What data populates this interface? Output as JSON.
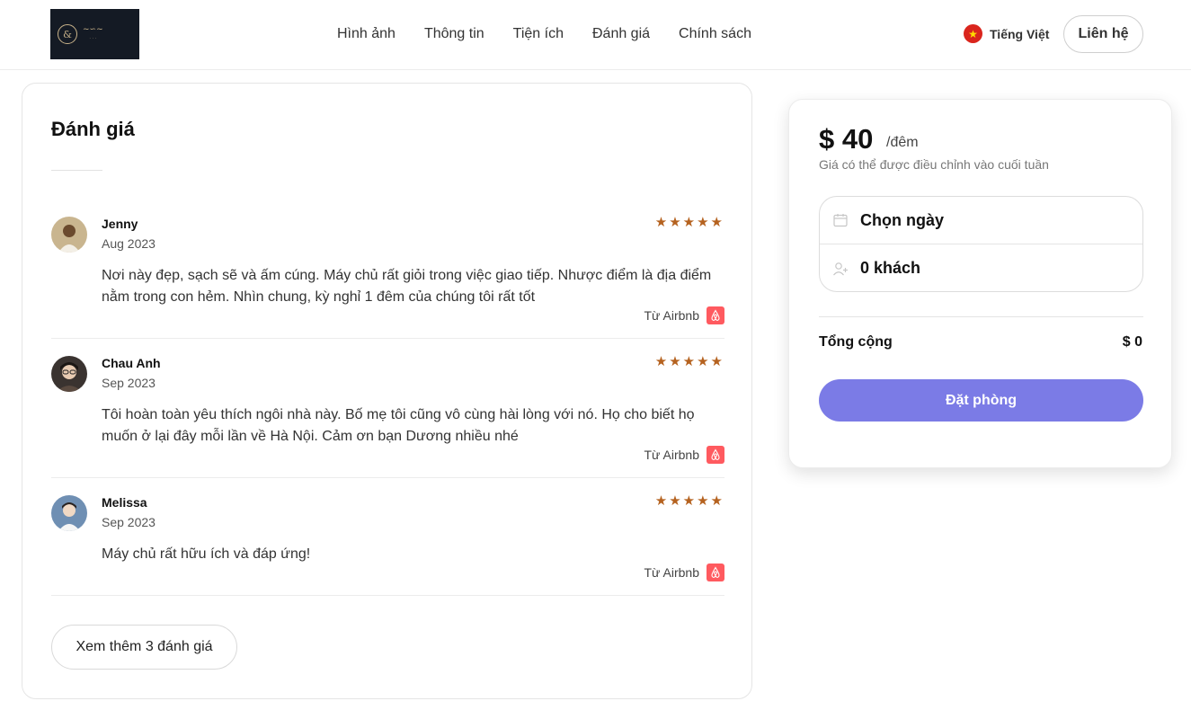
{
  "header": {
    "logo_icon": "monogram-logo-icon",
    "nav": [
      "Hình ảnh",
      "Thông tin",
      "Tiện ích",
      "Đánh giá",
      "Chính sách"
    ],
    "language": "Tiếng Việt",
    "language_icon": "vietnam-flag-icon",
    "contact_label": "Liên hệ"
  },
  "reviews": {
    "title": "Đánh giá",
    "items": [
      {
        "name": "Jenny",
        "date": "Aug 2023",
        "rating": 5,
        "text": "Nơi này đẹp, sạch sẽ và ấm cúng. Máy chủ rất giỏi trong việc giao tiếp. Nhược điểm là địa điểm nằm trong con hẻm. Nhìn chung, kỳ nghỉ 1 đêm của chúng tôi rất tốt",
        "source": "Từ Airbnb"
      },
      {
        "name": "Chau Anh",
        "date": "Sep 2023",
        "rating": 5,
        "text": "Tôi hoàn toàn yêu thích ngôi nhà này. Bố mẹ tôi cũng vô cùng hài lòng với nó. Họ cho biết họ muốn ở lại đây mỗi lần về Hà Nội. Cảm ơn bạn Dương nhiều nhé",
        "source": "Từ Airbnb"
      },
      {
        "name": "Melissa",
        "date": "Sep 2023",
        "rating": 5,
        "text": "Máy chủ rất hữu ích và đáp ứng!",
        "source": "Từ Airbnb"
      }
    ],
    "more_label": "Xem thêm 3 đánh giá"
  },
  "booking": {
    "price": "$ 40",
    "unit": "/đêm",
    "note": "Giá có thể được điều chỉnh vào cuối tuần",
    "date_label": "Chọn ngày",
    "date_icon": "calendar-icon",
    "guests_label": "0 khách",
    "guests_icon": "add-user-icon",
    "total_label": "Tổng cộng",
    "total_value": "$ 0",
    "book_label": "Đặt phòng"
  },
  "colors": {
    "accent": "#7b7be6",
    "star": "#b5621f",
    "airbnb": "#ff5a5f"
  }
}
